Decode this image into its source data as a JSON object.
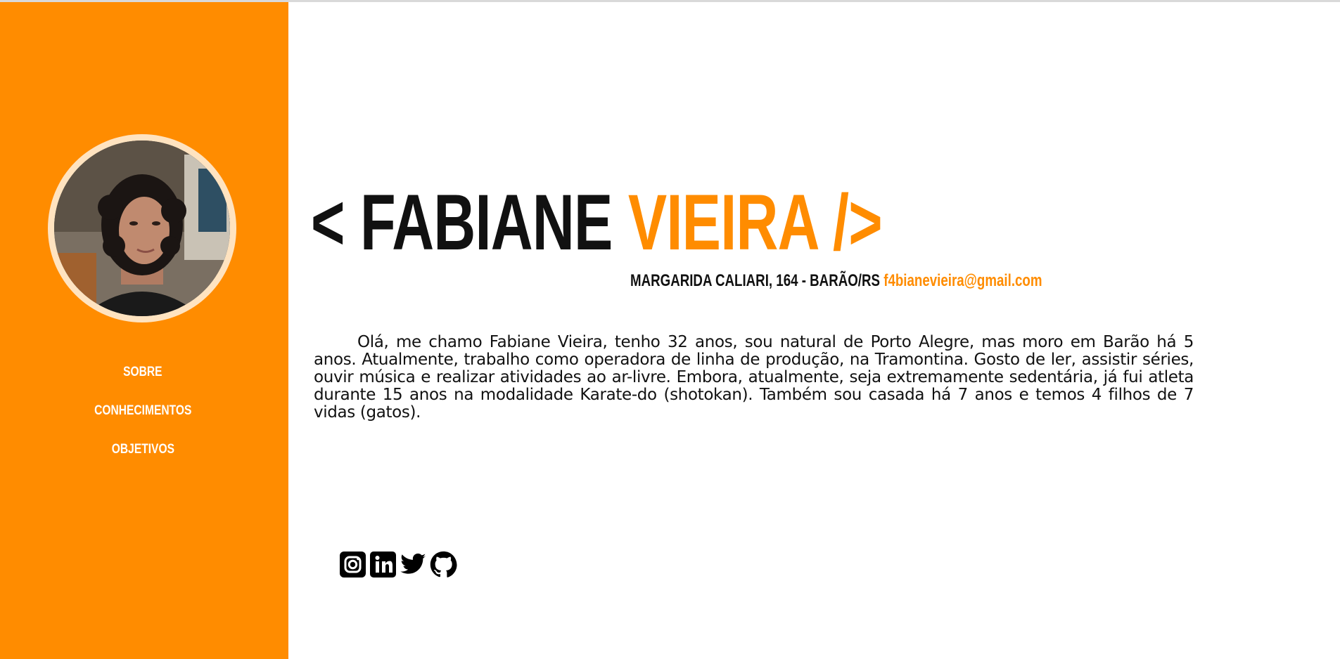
{
  "colors": {
    "accent": "#ff8c00",
    "text": "#111111",
    "sidebar_text": "#ffffff"
  },
  "sidebar": {
    "nav": [
      {
        "label": "SOBRE"
      },
      {
        "label": "CONHECIMENTOS"
      },
      {
        "label": "OBJETIVOS"
      }
    ]
  },
  "header": {
    "open_bracket": "< ",
    "first_name": "FABIANE",
    "last_name": "VIEIRA",
    "close_bracket": "/>",
    "address": "MARGARIDA CALIARI, 164 - BARÃO/RS",
    "email": "f4bianevieira@gmail.com"
  },
  "about": {
    "text": "Olá, me chamo Fabiane Vieira, tenho 32 anos, sou natural de Porto Alegre, mas moro em Barão há 5 anos. Atualmente, trabalho como operadora de linha de produção, na Tramontina. Gosto de ler, assistir séries, ouvir música e realizar atividades ao ar-livre. Embora, atualmente, seja extremamente sedentária, já fui atleta durante 15 anos na modalidade Karate-do (shotokan). Também sou casada há 7 anos e temos 4 filhos de 7 vidas (gatos)."
  },
  "social": {
    "icons": [
      "instagram-icon",
      "linkedin-icon",
      "twitter-icon",
      "github-icon"
    ]
  }
}
